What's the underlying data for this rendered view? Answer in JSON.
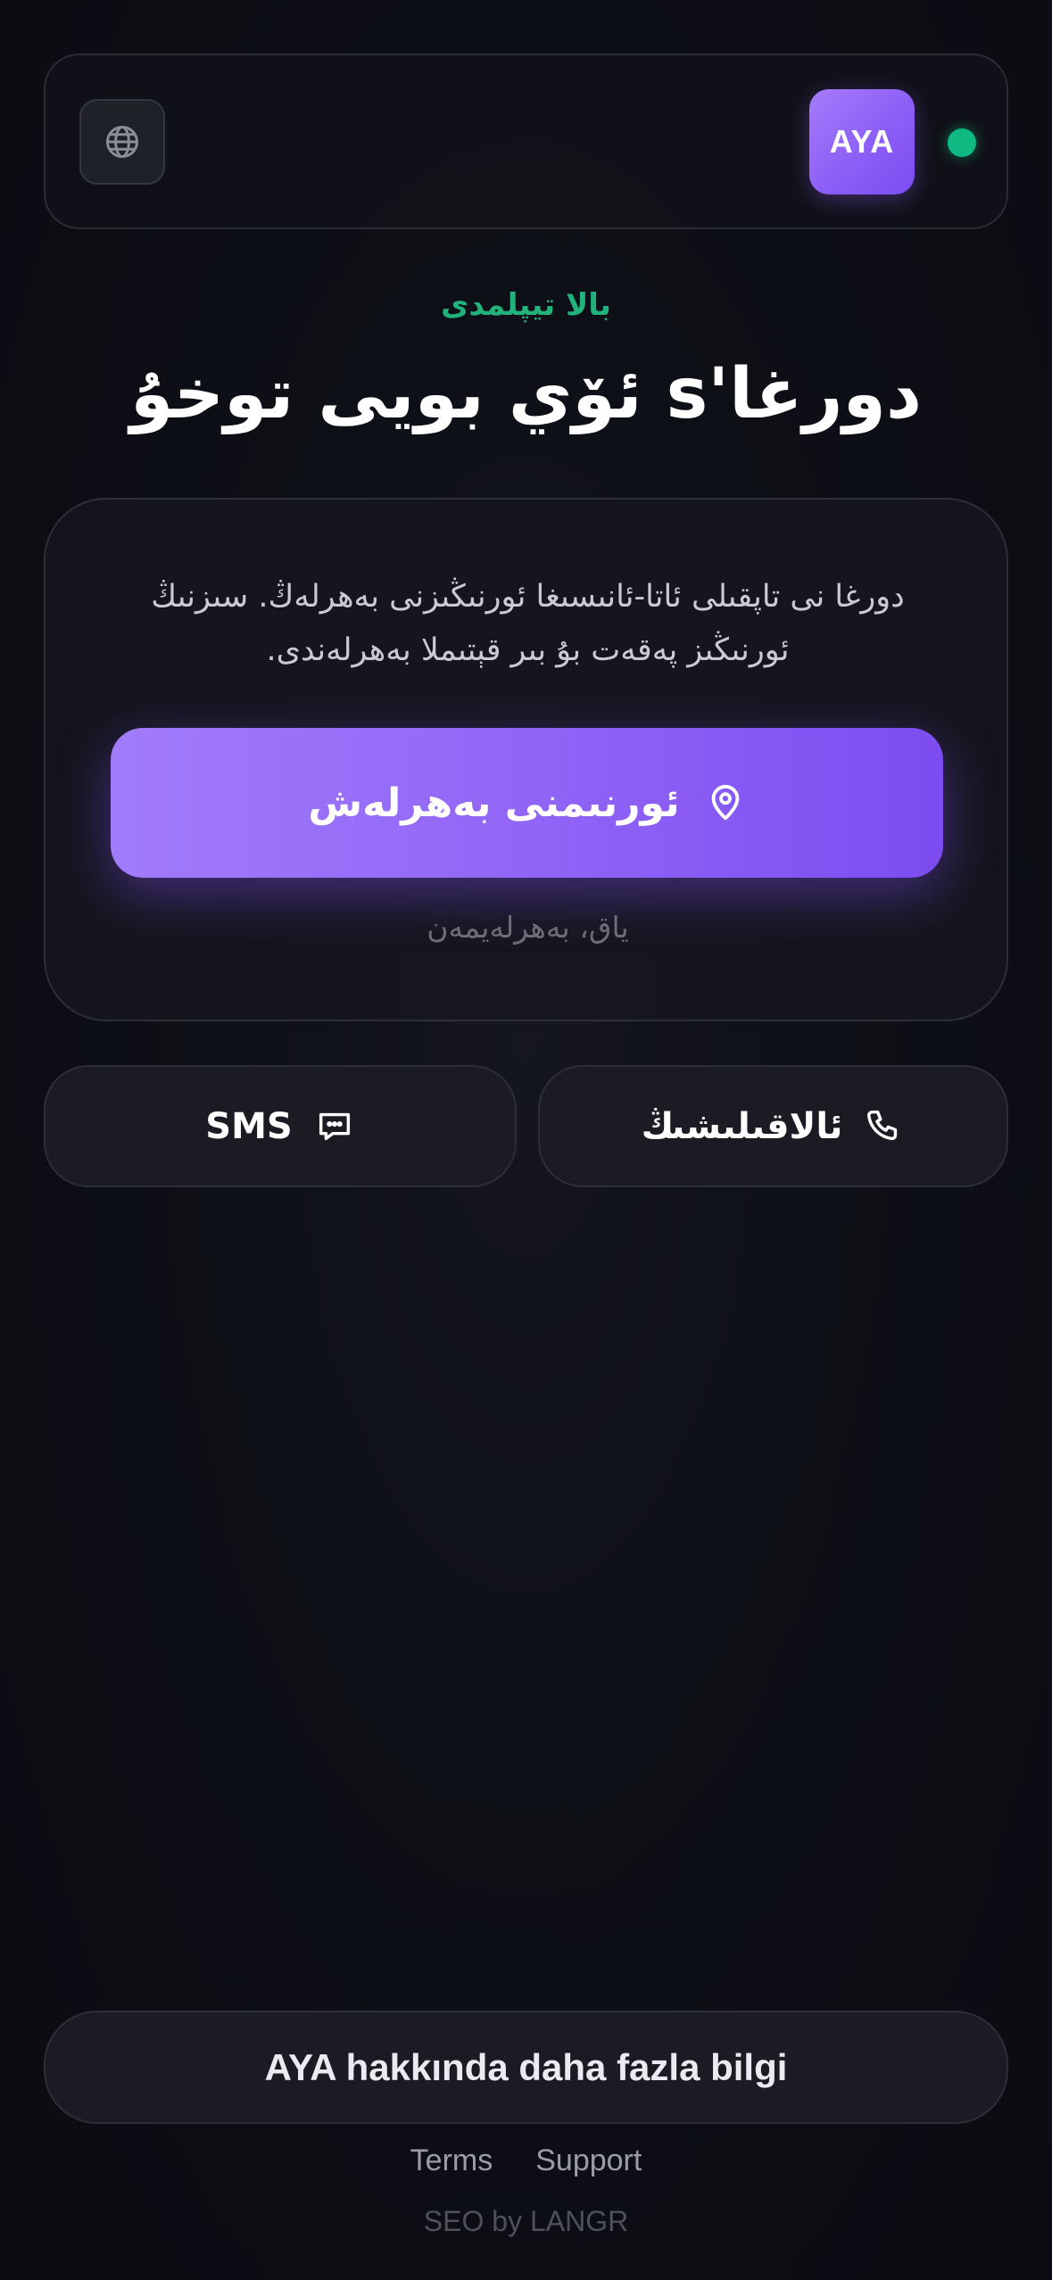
{
  "header": {
    "logo_text": "AYA",
    "status_color": "#10b981",
    "language_icon": "globe-icon"
  },
  "hero": {
    "eyebrow": "بالا تيپلمدى",
    "title": "دورغا's ئۆي بويى توخۇ"
  },
  "card": {
    "description": "دورغا نى تاپقىلى ئاتا-ئانىسىغا ئورنىڭىزنى بەھرلەڭ. سىزنىڭ ئورنىڭىز پەقەت بۇ بىر قېتىملا بەھرلەندى.",
    "cta_label": "ئورنىمنى بەھرلەش",
    "cta_icon": "location-pin-icon",
    "secondary": "ياق، بەھرلەيمەن"
  },
  "actions": {
    "call_label": "ئالاقىلىشىڭ",
    "call_icon": "phone-icon",
    "sms_label": "SMS",
    "sms_icon": "chat-bubble-icon"
  },
  "footer": {
    "more_info": "AYA hakkında daha fazla bilgi",
    "terms": "Terms",
    "support": "Support",
    "credit": "SEO by LANGR"
  },
  "colors": {
    "accent": "#8b5cf6",
    "success": "#10b981",
    "background": "#0e1017"
  }
}
